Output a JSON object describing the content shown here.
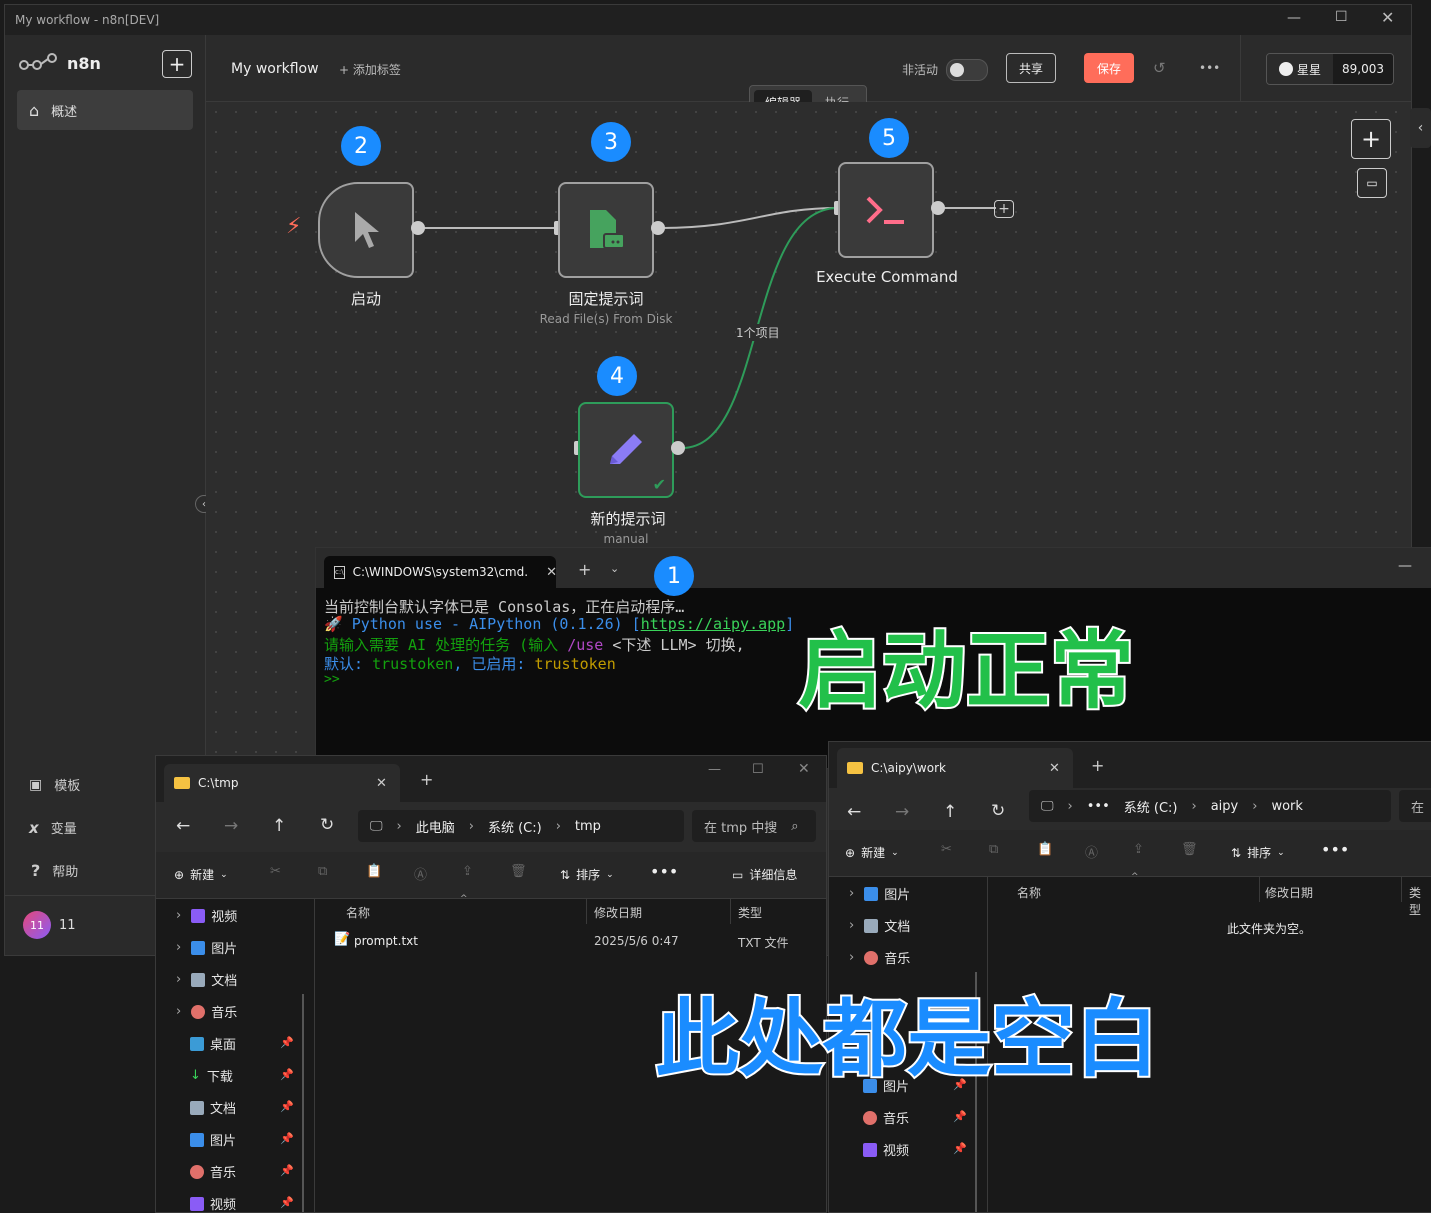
{
  "window": {
    "title": "My workflow - n8n[DEV]"
  },
  "sidebar": {
    "brand": "n8n",
    "items": [
      {
        "label": "概述"
      },
      {
        "label": "模板"
      },
      {
        "label": "变量"
      },
      {
        "label": "帮助"
      }
    ],
    "user_badge": "11",
    "user_name": "11"
  },
  "header": {
    "workflow_name": "My workflow",
    "add_tag": "+ 添加标签",
    "inactive_label": "非活动",
    "share_label": "共享",
    "save_label": "保存",
    "more_label": "•••",
    "star_label": "星星",
    "star_count": "89,003",
    "tabs": [
      {
        "label": "编辑器"
      },
      {
        "label": "执行"
      }
    ]
  },
  "nodes": {
    "trigger": {
      "label": "启动",
      "badge": "2"
    },
    "read_file": {
      "label": "固定提示词",
      "sub": "Read File(s) From Disk",
      "badge": "3"
    },
    "manual": {
      "label": "新的提示词",
      "sub": "manual",
      "badge": "4"
    },
    "exec": {
      "label": "Execute Command",
      "badge": "5"
    },
    "edge_label": "1个项目"
  },
  "cmd": {
    "tab_title": "C:\\WINDOWS\\system32\\cmd.",
    "badge": "1",
    "lines": {
      "l1": "当前控制台默认字体已是 Consolas，正在启动程序…",
      "l2a": "🚀 Python use - AIPython (0.1.26) [",
      "l2b": "https://aipy.app",
      "l2c": "]",
      "l3a": "请输入需要 AI 处理的任务 (输入 ",
      "l3b": "/use",
      "l3c": " <下述 LLM> 切换,",
      "l4a": "默认: ",
      "l4b": "trustoken",
      "l4c": ", 已启用: ",
      "l4d": "trustoken",
      "l5": ">>"
    }
  },
  "overlay": {
    "ok": "启动正常",
    "blank": "此处都是空白"
  },
  "explorer1": {
    "title": "C:\\tmp",
    "breadcrumb": [
      "此电脑",
      "系统 (C:)",
      "tmp"
    ],
    "search_placeholder": "在 tmp 中搜",
    "new_label": "新建",
    "sort_label": "排序",
    "details_label": "详细信息",
    "columns": [
      "名称",
      "修改日期",
      "类型"
    ],
    "files": [
      {
        "name": "prompt.txt",
        "date": "2025/5/6 0:47",
        "type": "TXT 文件"
      }
    ],
    "tree": [
      "视频",
      "图片",
      "文档",
      "音乐",
      "桌面",
      "下载",
      "文档",
      "图片",
      "音乐",
      "视频"
    ]
  },
  "explorer2": {
    "title": "C:\\aipy\\work",
    "breadcrumb": [
      "•••",
      "系统 (C:)",
      "aipy",
      "work"
    ],
    "search_placeholder": "在",
    "new_label": "新建",
    "sort_label": "排序",
    "columns": [
      "名称",
      "修改日期",
      "类型"
    ],
    "empty_text": "此文件夹为空。",
    "tree": [
      "图片",
      "文档",
      "音乐",
      "图片",
      "音乐",
      "视频"
    ]
  },
  "colors": {
    "save": "#ff6d5a",
    "badge": "#1a8cff",
    "green_node": "#2e8b57",
    "overlay_green": "#22c04a",
    "overlay_blue": "#1a8cff"
  }
}
